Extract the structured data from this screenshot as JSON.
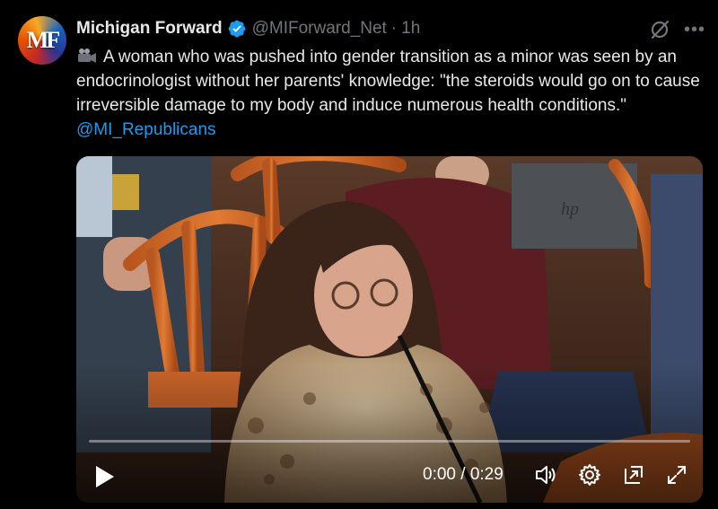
{
  "tweet": {
    "author": "Michigan Forward",
    "handle": "@MIForward_Net",
    "separator": "·",
    "time": "1h",
    "avatar_text": "MF",
    "body": "A woman who was pushed into gender transition as a minor was seen by an endocrinologist without her parents' knowledge: \"the steroids would go on to cause irreversible damage to my body and induce numerous health conditions.\" ",
    "mention": "@MI_Republicans",
    "media_icon": "video-camera-icon",
    "more_label": "•••"
  },
  "video": {
    "timecode": "0:00 / 0:29",
    "progress": 0,
    "laptop_logo": "hp"
  },
  "colors": {
    "accent": "#1d9bf0",
    "verified": "#1d9bf0",
    "muted": "#71767b",
    "text": "#e7e9ea"
  }
}
